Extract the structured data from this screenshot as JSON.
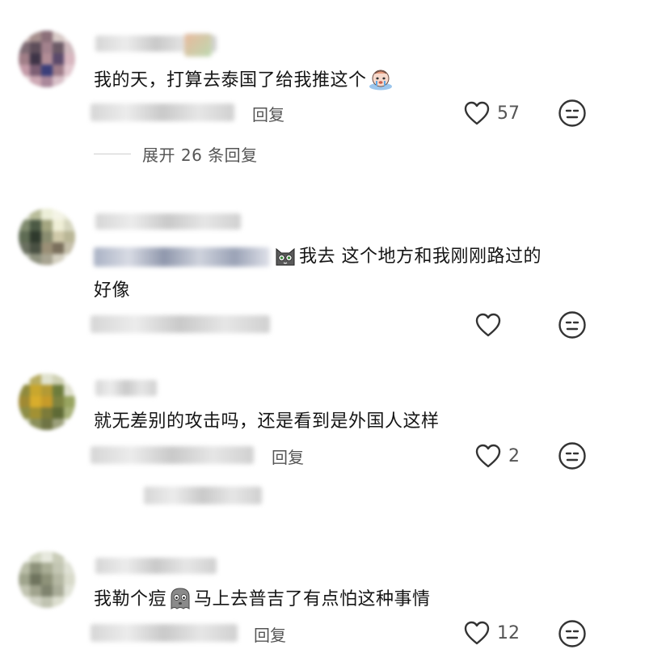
{
  "comments": [
    {
      "text": "我的天，打算去泰国了给我推这个",
      "reply_label": "回复",
      "likes": "57",
      "expand_label": "展开 26 条回复",
      "emoji": "crying-face-emoji"
    },
    {
      "text_line1": "我去 这个地方和我刚刚路过的",
      "text_line2": "好像",
      "likes": "",
      "emoji": "cat-face-emoji"
    },
    {
      "text": "就无差别的攻击吗，还是看到是外国人这样",
      "reply_label": "回复",
      "likes": "2"
    },
    {
      "text_before": "我勒个痘",
      "text_after": "马上去普吉了有点怕这种事情",
      "reply_label": "回复",
      "likes": "12",
      "emoji": "ghost-face-emoji"
    }
  ],
  "colors": {
    "text": "#151515",
    "meta": "#555555",
    "icon_stroke": "#333333"
  }
}
